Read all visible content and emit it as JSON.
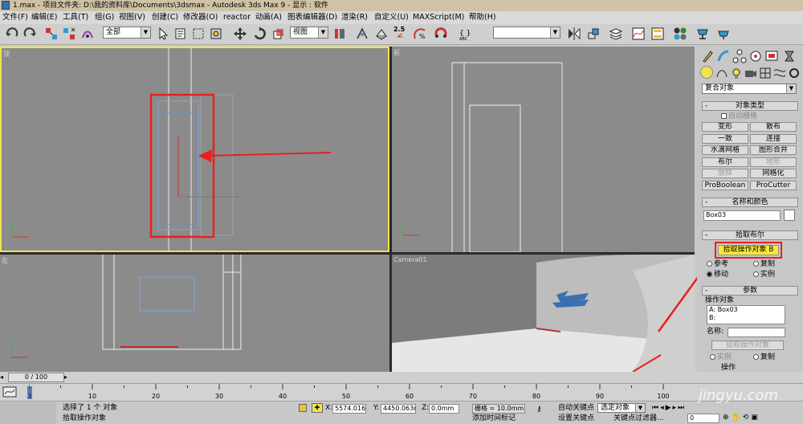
{
  "window": {
    "title": "1.max      - 项目文件夹: D:\\我的资料库\\Documents\\3dsmax      - Autodesk 3ds Max 9      - 显示 : 软件"
  },
  "menu": [
    "文件(F)",
    "编辑(E)",
    "工具(T)",
    "组(G)",
    "视图(V)",
    "创建(C)",
    "修改器(O)",
    "reactor",
    "动画(A)",
    "图表编辑器(D)",
    "渲染(R)",
    "自定义(U)",
    "MAXScript(M)",
    "帮助(H)"
  ],
  "toolbar": {
    "selection_filter": "全部",
    "ref_coord": "视图",
    "named_selection": "",
    "snap_value": "2.5"
  },
  "viewports": {
    "top": {
      "label": "顶"
    },
    "front": {
      "label": "前"
    },
    "left": {
      "label": "左"
    },
    "camera": {
      "label": "Camera01"
    }
  },
  "command_panel": {
    "category_dropdown": "复合对象",
    "object_type": {
      "title": "对象类型",
      "autogrid": "自动栅格",
      "buttons": [
        {
          "label": "变形",
          "enabled": true
        },
        {
          "label": "散布",
          "enabled": true
        },
        {
          "label": "一致",
          "enabled": true
        },
        {
          "label": "连接",
          "enabled": true
        },
        {
          "label": "水滴网格",
          "enabled": true
        },
        {
          "label": "图形合并",
          "enabled": true
        },
        {
          "label": "布尔",
          "enabled": true
        },
        {
          "label": "地形",
          "enabled": false
        },
        {
          "label": "放样",
          "enabled": false
        },
        {
          "label": "网格化",
          "enabled": true
        },
        {
          "label": "ProBoolean",
          "enabled": true
        },
        {
          "label": "ProCutter",
          "enabled": true
        }
      ]
    },
    "name_color": {
      "title": "名称和颜色",
      "name_value": "Box03",
      "color": "#ffffff"
    },
    "pick_boolean": {
      "title": "拾取布尔",
      "pick_button": "拾取操作对象 B",
      "options": [
        {
          "label": "参考",
          "selected": false
        },
        {
          "label": "复制",
          "selected": false
        },
        {
          "label": "移动",
          "selected": true
        },
        {
          "label": "实例",
          "selected": false
        }
      ]
    },
    "parameters": {
      "title": "参数",
      "operands_label": "操作对象",
      "operands": [
        "A: Box03",
        "B:"
      ],
      "name_label": "名称:",
      "extract_button": "提取操作对象",
      "extract_options": [
        "实例",
        "复制"
      ],
      "operation_label": "操作"
    }
  },
  "timeline": {
    "frame_display": "0 / 100",
    "ticks": [
      "0",
      "10",
      "20",
      "30",
      "40",
      "50",
      "60",
      "70",
      "80",
      "90",
      "100"
    ]
  },
  "status": {
    "selected_text": "选择了 1 个 对象",
    "prompt": "拾取操作对象",
    "x_label": "X:",
    "x_value": "5574.016m",
    "y_label": "Y:",
    "y_value": "4450.063m",
    "z_label": "Z:",
    "z_value": "0.0mm",
    "grid": "栅格 = 10.0mm",
    "add_time_tag": "添加时间标记",
    "auto_key": "自动关键点",
    "set_key": "设置关键点",
    "key_mode": "选定对象",
    "key_filters": "关键点过滤器...",
    "current_frame": "0"
  },
  "watermark": "jingyu.com",
  "colors": {
    "active_viewport_border": "#f2e24c",
    "annotation_red": "#e8201f",
    "highlight_button": "#f7ea3a",
    "viewport_bg": "#8b8b8b"
  },
  "icons": [
    "undo-icon",
    "redo-icon",
    "select-link-icon",
    "unlink-icon",
    "bind-space-warp-icon",
    "select-object-icon",
    "select-by-name-icon",
    "region-select-icon",
    "window-crossing-icon",
    "move-icon",
    "rotate-icon",
    "scale-icon",
    "pivot-icon",
    "manipulate-icon",
    "snap-icon",
    "angle-snap-icon",
    "percent-snap-icon",
    "spinner-snap-icon",
    "edit-named-selection-icon",
    "mirror-icon",
    "align-icon",
    "layer-manager-icon",
    "curve-editor-icon",
    "schematic-view-icon",
    "material-editor-icon",
    "render-scene-icon",
    "quick-render-icon",
    "create-tab-icon",
    "modify-tab-icon",
    "hierarchy-tab-icon",
    "motion-tab-icon",
    "display-tab-icon",
    "utilities-tab-icon"
  ]
}
